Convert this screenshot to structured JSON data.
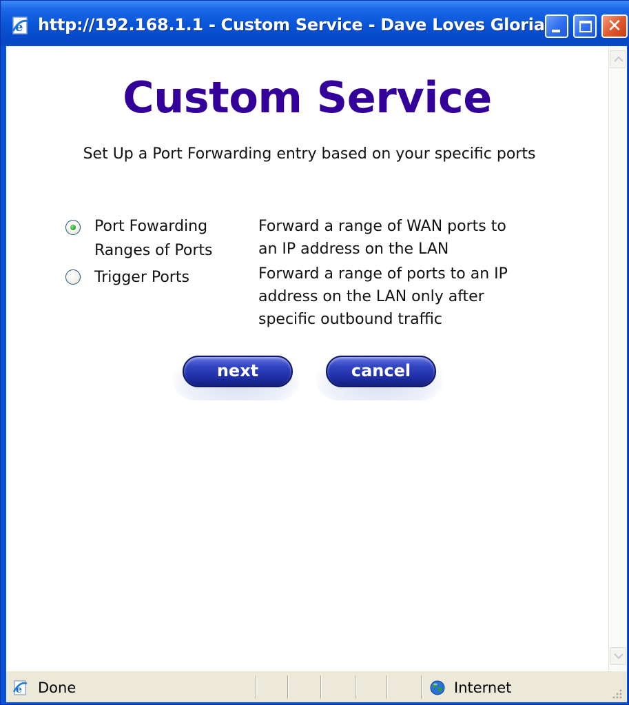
{
  "window": {
    "title": "http://192.168.1.1 - Custom Service - Dave Loves Gloria!",
    "title_bar_color": "#0a52d6",
    "buttons": [
      "minimize",
      "maximize",
      "close"
    ]
  },
  "page": {
    "title": "Custom Service",
    "title_color": "#330099",
    "intro": "Set Up a Port Forwarding entry based on your specific ports",
    "options": [
      {
        "label_line1": "Port Fowarding",
        "label_line2": "Ranges of Ports",
        "desc_line1": "Forward a range of WAN ports to",
        "desc_line2": "an IP address on the LAN",
        "selected": true
      },
      {
        "label_line1": "Trigger Ports",
        "desc_line1": "Forward a range of ports to an IP",
        "desc_line2": "address on the LAN only after",
        "desc_line3": "specific outbound traffic",
        "selected": false
      }
    ],
    "buttons": {
      "next_label": "next",
      "cancel_label": "cancel",
      "color": "#1f2ea6"
    }
  },
  "statusbar": {
    "status_text": "Done",
    "status_icon": "ie-page-icon",
    "zone_text": "Internet",
    "zone_icon": "globe-icon"
  }
}
